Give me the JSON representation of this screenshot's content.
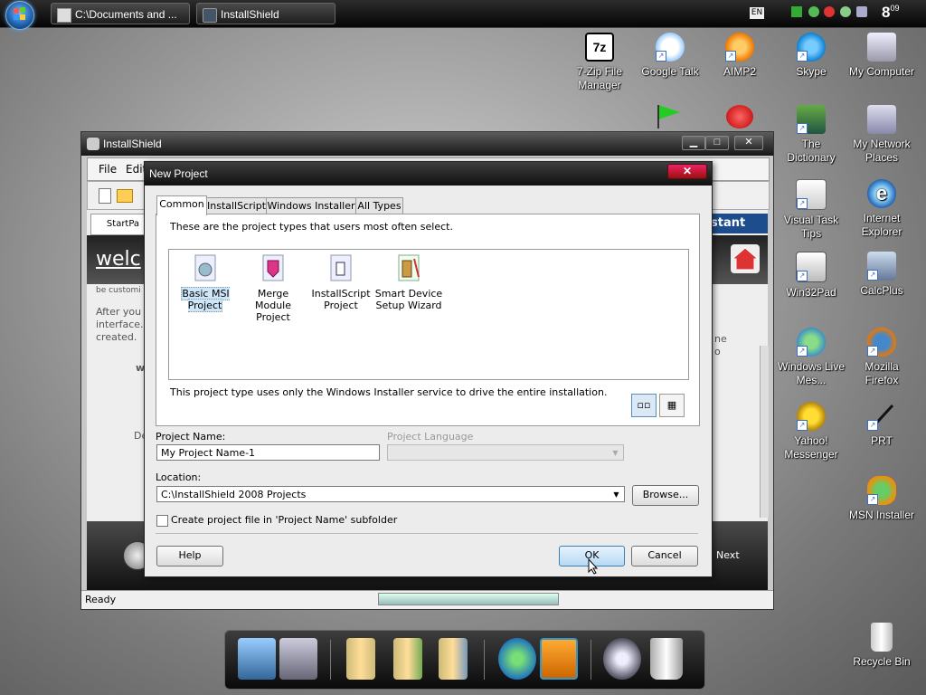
{
  "taskbar": {
    "tasks": [
      {
        "label": "C:\\Documents and ..."
      },
      {
        "label": "InstallShield"
      }
    ],
    "language": "EN",
    "clock": {
      "hour": "8",
      "minute": "09"
    }
  },
  "desktop_icons": [
    {
      "label": "7-Zip File Manager"
    },
    {
      "label": "Google Talk"
    },
    {
      "label": "AIMP2"
    },
    {
      "label": "Skype"
    },
    {
      "label": "My Computer"
    },
    {
      "label": "The Dictionary"
    },
    {
      "label": "My Network Places"
    },
    {
      "label": "Visual Task Tips"
    },
    {
      "label": "Internet Explorer"
    },
    {
      "label": "Win32Pad"
    },
    {
      "label": "CalcPlus"
    },
    {
      "label": "Windows Live Mes..."
    },
    {
      "label": "Mozilla Firefox"
    },
    {
      "label": "Yahoo! Messenger"
    },
    {
      "label": "PRT"
    },
    {
      "label": "MSN Installer"
    },
    {
      "label": "Recycle Bin"
    }
  ],
  "main_window": {
    "title": "InstallShield",
    "menu": {
      "file": "File",
      "edit": "Edit"
    },
    "start_tab": "StartPa",
    "welcome": "welc",
    "assistant": "stant",
    "body_text": {
      "line1": "be customi",
      "line2": "After you h",
      "line3": "interface. T",
      "line4": "created.",
      "frag_w": "w",
      "frag_de": "De",
      "frag_ne": "ne",
      "frag_o": "o"
    },
    "next": "Next",
    "status": "Ready"
  },
  "dialog": {
    "title": "New Project",
    "tabs": [
      "Common",
      "InstallScript",
      "Windows Installer",
      "All Types"
    ],
    "active_tab": "Common",
    "desc_top": "These are the project types that users most often select.",
    "project_types": [
      {
        "line1": "Basic MSI",
        "line2": "Project",
        "selected": true
      },
      {
        "line1": "Merge Module",
        "line2": "Project",
        "selected": false
      },
      {
        "line1": "InstallScript",
        "line2": "Project",
        "selected": false
      },
      {
        "line1": "Smart Device",
        "line2": "Setup Wizard",
        "selected": false
      }
    ],
    "desc_bottom": "This project type uses only the Windows Installer service to drive the entire installation.",
    "project_name_label": "Project Name:",
    "project_name_value": "My Project Name-1",
    "project_language_label": "Project Language",
    "location_label": "Location:",
    "location_value": "C:\\InstallShield 2008 Projects",
    "browse": "Browse...",
    "checkbox_label": "Create project file in 'Project Name' subfolder",
    "checkbox_checked": false,
    "help": "Help",
    "ok": "OK",
    "cancel": "Cancel"
  },
  "colors": {
    "titlebar": "#161616",
    "close": "#c01818",
    "selection": "#cfe6f8",
    "ok_button": "#b6d9f4"
  }
}
